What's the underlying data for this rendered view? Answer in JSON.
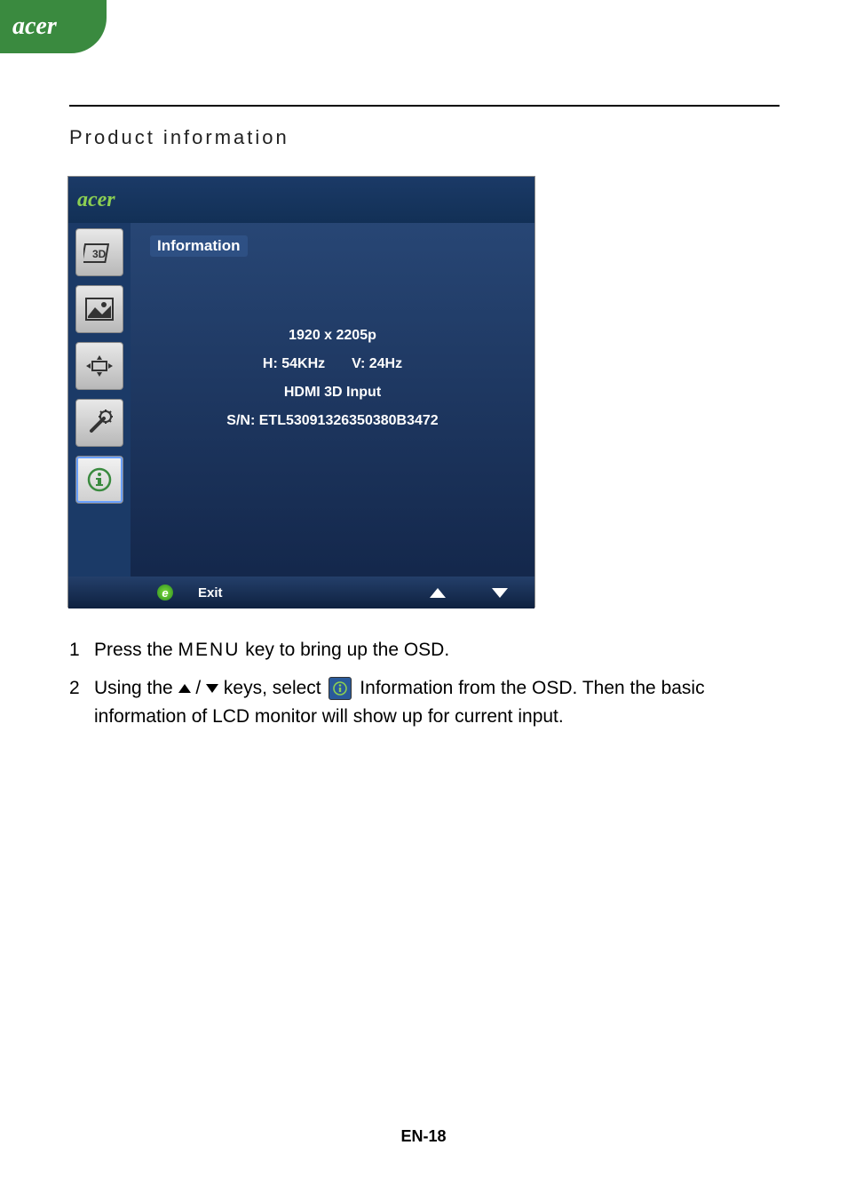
{
  "header": {
    "brand": "acer"
  },
  "section": {
    "title": "Product information"
  },
  "osd": {
    "brand": "acer",
    "tab_title": "Information",
    "info": {
      "resolution": "1920 x 2205p",
      "hfreq": "H: 54KHz",
      "vfreq": "V: 24Hz",
      "input": "HDMI 3D Input",
      "serial": "S/N: ETL53091326350380B3472"
    },
    "footer": {
      "exit": "Exit"
    },
    "sidebar_icons": [
      "3d-icon",
      "picture-icon",
      "position-icon",
      "settings-icon",
      "info-icon"
    ]
  },
  "instructions": {
    "step1_pre": "Press the ",
    "step1_key": "MENU",
    "step1_post": " key to bring up the OSD.",
    "step2_a": "Using the ",
    "step2_b": " / ",
    "step2_c": " keys, select ",
    "step2_d": " Information from the OSD. Then the basic information of LCD monitor will show up for current input."
  },
  "page_number": "EN-18"
}
